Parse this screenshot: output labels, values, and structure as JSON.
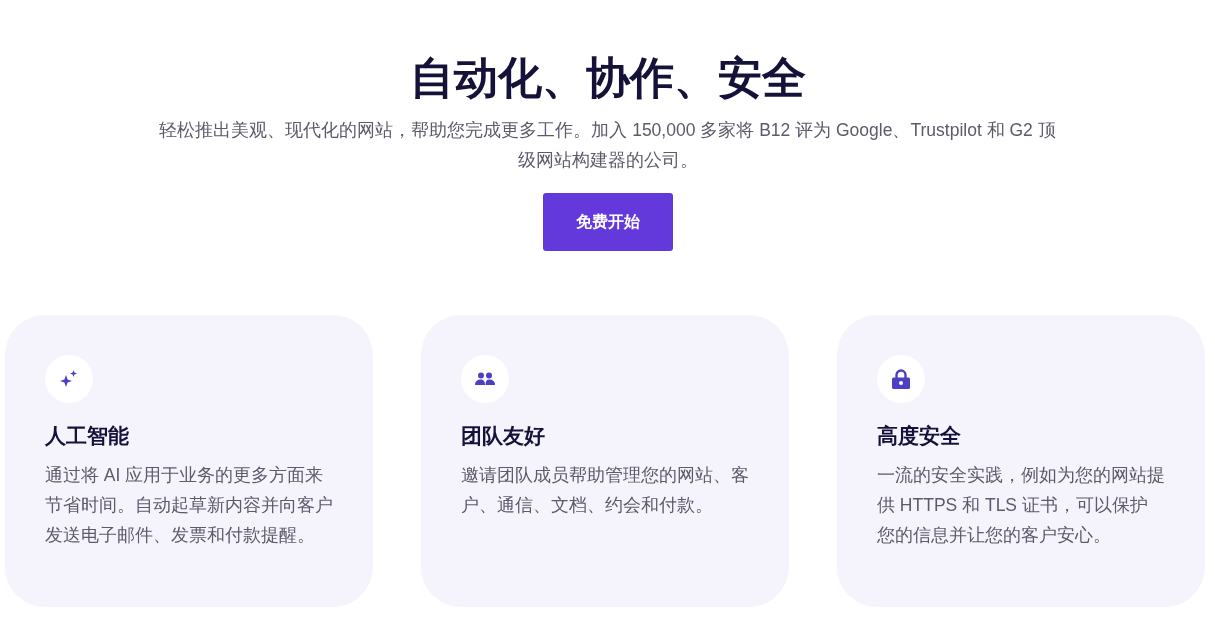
{
  "hero": {
    "title": "自动化、协作、安全",
    "subtitle": "轻松推出美观、现代化的网站，帮助您完成更多工作。加入 150,000 多家将 B12 评为 Google、Trustpilot 和 G2 顶级网站构建器的公司。",
    "button": "免费开始"
  },
  "features": [
    {
      "title": "人工智能",
      "text": "通过将 AI 应用于业务的更多方面来节省时间。自动起草新内容并向客户发送电子邮件、发票和付款提醒。"
    },
    {
      "title": "团队友好",
      "text": "邀请团队成员帮助管理您的网站、客户、通信、文档、约会和付款。"
    },
    {
      "title": "高度安全",
      "text": "一流的安全实践，例如为您的网站提供 HTTPS 和 TLS 证书，可以保护您的信息并让您的客户安心。"
    }
  ]
}
